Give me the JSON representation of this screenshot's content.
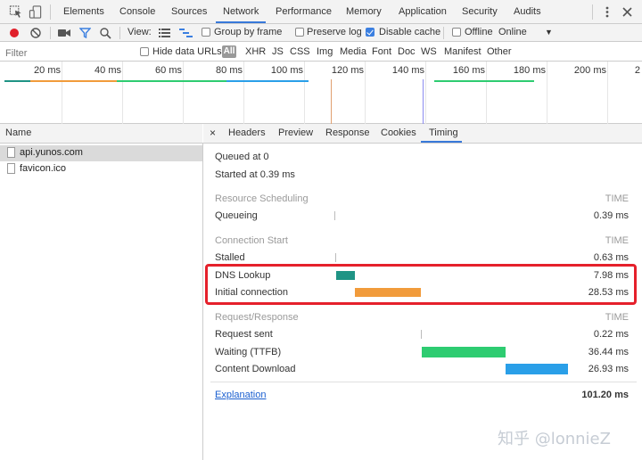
{
  "tabs": [
    "Elements",
    "Console",
    "Sources",
    "Network",
    "Performance",
    "Memory",
    "Application",
    "Security",
    "Audits"
  ],
  "toolbar": {
    "view_label": "View:",
    "group_by_frame": "Group by frame",
    "preserve_log": "Preserve log",
    "disable_cache": "Disable cache",
    "offline": "Offline",
    "throttle": "Online",
    "disable_cache_checked": true
  },
  "filter": {
    "placeholder": "Filter",
    "hide_data_urls": "Hide data URLs",
    "all": "All",
    "types": [
      "XHR",
      "JS",
      "CSS",
      "Img",
      "Media",
      "Font",
      "Doc",
      "WS",
      "Manifest",
      "Other"
    ]
  },
  "overview": {
    "ticks": [
      "20 ms",
      "40 ms",
      "60 ms",
      "80 ms",
      "100 ms",
      "120 ms",
      "140 ms",
      "160 ms",
      "180 ms",
      "200 ms",
      "2"
    ]
  },
  "requests": {
    "header": "Name",
    "items": [
      "api.yunos.com",
      "favicon.ico"
    ]
  },
  "detail_tabs": [
    "×",
    "Headers",
    "Preview",
    "Response",
    "Cookies",
    "Timing"
  ],
  "timing": {
    "queued_at": "Queued at 0",
    "started_at": "Started at 0.39 ms",
    "time_label": "TIME",
    "sections": {
      "scheduling": "Resource Scheduling",
      "connection": "Connection Start",
      "request": "Request/Response"
    },
    "rows": [
      {
        "label": "Queueing",
        "value": "0.39 ms"
      },
      {
        "label": "Stalled",
        "value": "0.63 ms"
      },
      {
        "label": "DNS Lookup",
        "value": "7.98 ms"
      },
      {
        "label": "Initial connection",
        "value": "28.53 ms"
      },
      {
        "label": "Request sent",
        "value": "0.22 ms"
      },
      {
        "label": "Waiting (TTFB)",
        "value": "36.44 ms"
      },
      {
        "label": "Content Download",
        "value": "26.93 ms"
      }
    ],
    "explanation": "Explanation",
    "total": "101.20 ms"
  },
  "colors": {
    "dns": "#1f9485",
    "initial_connection": "#f19b3b",
    "waiting": "#2ecc71",
    "download": "#2a9fe8",
    "highlight": "#e5202b"
  },
  "watermark": "知乎 @lonnieZ"
}
